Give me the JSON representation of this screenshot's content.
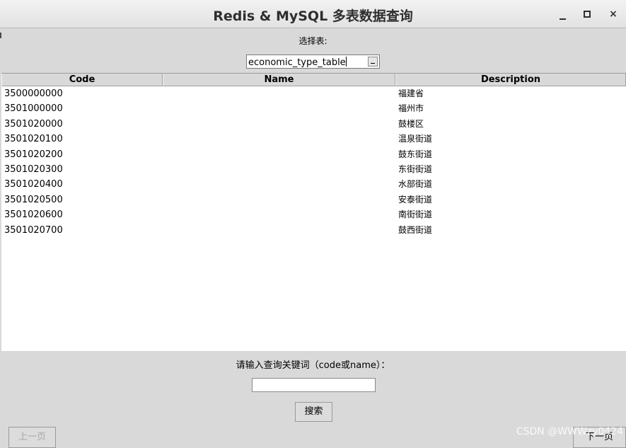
{
  "window": {
    "title": "Redis & MySQL 多表数据查询",
    "controls": [
      "minimize",
      "maximize",
      "close"
    ],
    "close_symbol": "×"
  },
  "table_select": {
    "label": "选择表:",
    "value": "economic_type_table"
  },
  "table": {
    "columns": [
      "Code",
      "Name",
      "Description"
    ],
    "rows": [
      {
        "code": "3500000000",
        "name": "",
        "desc": "福建省"
      },
      {
        "code": "3501000000",
        "name": "",
        "desc": "福州市"
      },
      {
        "code": "3501020000",
        "name": "",
        "desc": "鼓楼区"
      },
      {
        "code": "3501020100",
        "name": "",
        "desc": "温泉街道"
      },
      {
        "code": "3501020200",
        "name": "",
        "desc": "鼓东街道"
      },
      {
        "code": "3501020300",
        "name": "",
        "desc": "东街街道"
      },
      {
        "code": "3501020400",
        "name": "",
        "desc": "水部街道"
      },
      {
        "code": "3501020500",
        "name": "",
        "desc": "安泰街道"
      },
      {
        "code": "3501020600",
        "name": "",
        "desc": "南街街道"
      },
      {
        "code": "3501020700",
        "name": "",
        "desc": "鼓西街道"
      }
    ]
  },
  "search": {
    "label": "请输入查询关键词（code或name）：",
    "value": "",
    "button_label": "搜索"
  },
  "pagination": {
    "prev_label": "上一页",
    "next_label": "下一页"
  },
  "watermark": "CSDN @WWWzy0424"
}
